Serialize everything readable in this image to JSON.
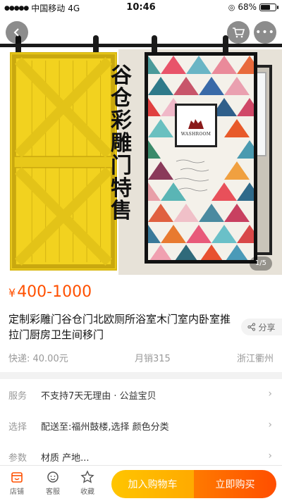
{
  "status_bar": {
    "carrier": "中国移动",
    "network": "4G",
    "time": "10:46",
    "battery": "68%",
    "battery_level": 0.68
  },
  "gallery": {
    "promo_text": "谷仓彩雕门特售",
    "logo_text": "WASHROOM",
    "counter": "1/5"
  },
  "product": {
    "currency": "¥",
    "price": "400-1000",
    "title": "定制彩雕门谷仓门北欧厕所浴室木门室内卧室推拉门厨房卫生间移门",
    "share_label": "分享",
    "shipping": "快递: 40.00元",
    "sales": "月销315",
    "location": "浙江衢州"
  },
  "rows": [
    {
      "label": "服务",
      "value": "不支持7天无理由 · 公益宝贝"
    },
    {
      "label": "选择",
      "value": "配送至:福州鼓楼,选择 颜色分类"
    },
    {
      "label": "参数",
      "value": "材质 产地..."
    }
  ],
  "bottom_bar": {
    "shop": "店铺",
    "service": "客服",
    "favorite": "收藏",
    "add_to_cart": "加入购物车",
    "buy_now": "立即购买"
  },
  "colors": {
    "accent": "#ff5000",
    "cart_button": "#ffb300",
    "buy_button": "#ff5a00",
    "door_yellow": "#f2d21f"
  },
  "icons": [
    "back-icon",
    "cart-icon",
    "more-icon",
    "share-icon",
    "shop-icon",
    "service-icon",
    "star-icon",
    "chevron-right-icon"
  ]
}
